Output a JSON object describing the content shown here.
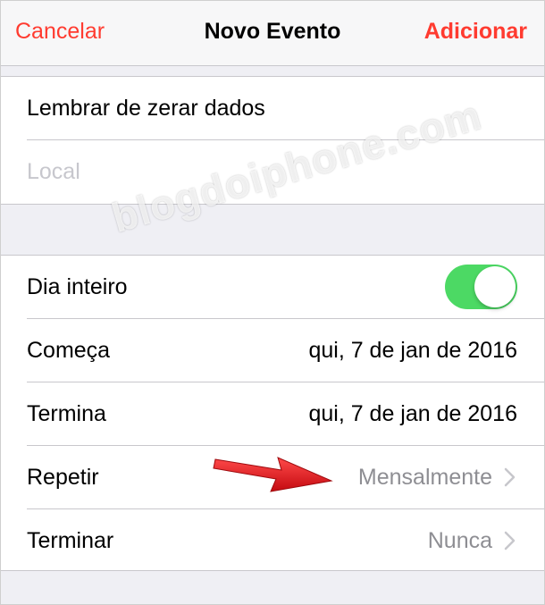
{
  "navbar": {
    "cancel_label": "Cancelar",
    "title": "Novo Evento",
    "add_label": "Adicionar"
  },
  "event": {
    "title_value": "Lembrar de zerar dados",
    "location_placeholder": "Local"
  },
  "details": {
    "all_day_label": "Dia inteiro",
    "all_day_on": true,
    "starts_label": "Começa",
    "starts_value": "qui, 7 de jan de 2016",
    "ends_label": "Termina",
    "ends_value": "qui, 7 de jan de 2016",
    "repeat_label": "Repetir",
    "repeat_value": "Mensalmente",
    "end_repeat_label": "Terminar",
    "end_repeat_value": "Nunca"
  },
  "watermark": "blogdoiphone.com",
  "colors": {
    "accent": "#ff3b30",
    "toggle_on": "#4cd964",
    "arrow": "#e8141b"
  },
  "icons": {
    "chevron": "chevron-right-icon",
    "arrow": "red-arrow-icon"
  }
}
